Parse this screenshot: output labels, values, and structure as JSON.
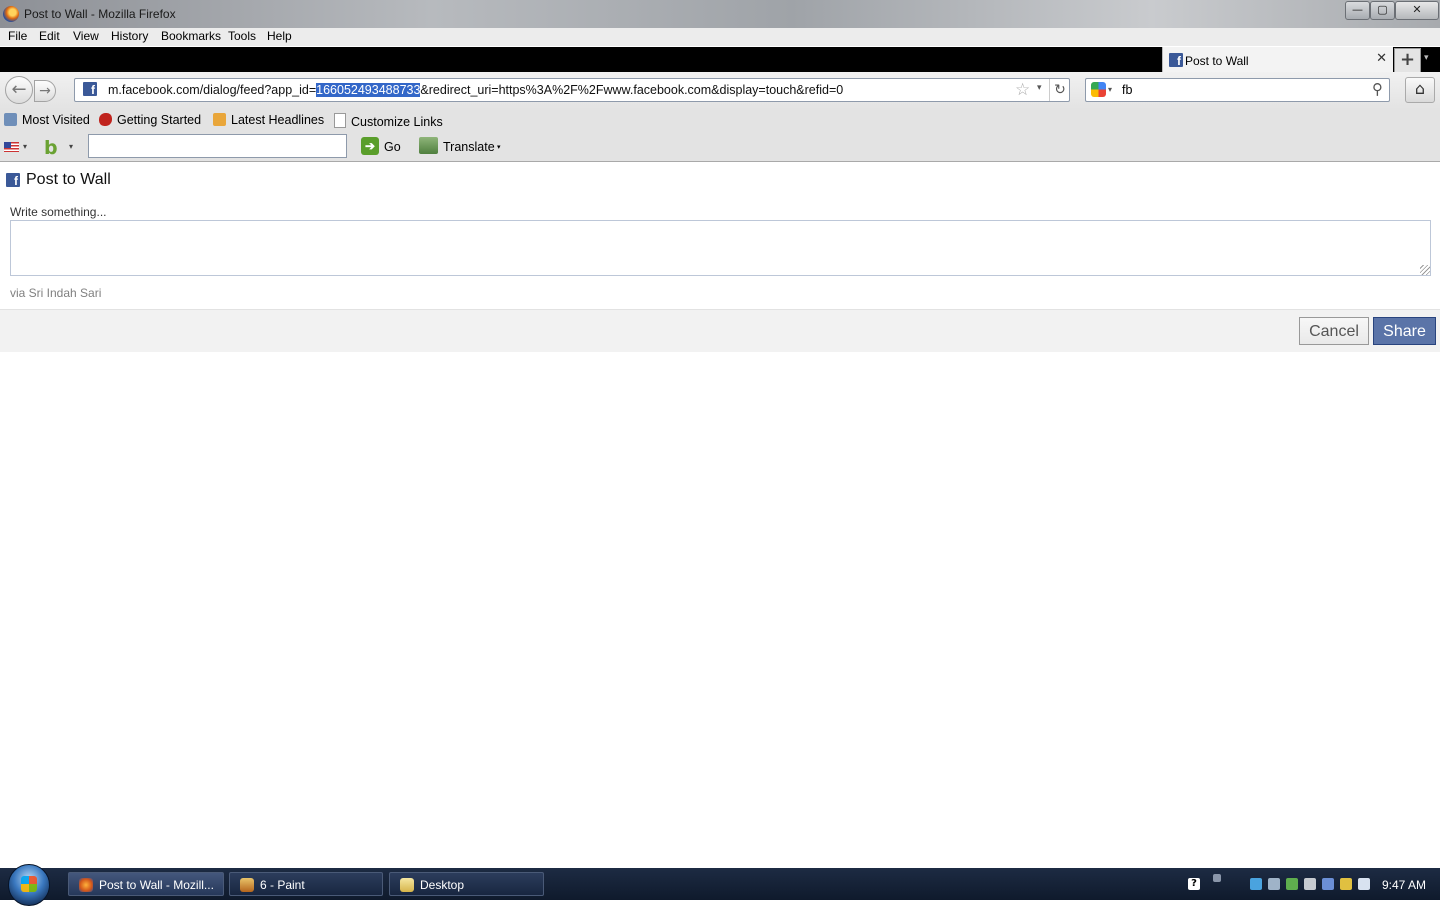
{
  "window": {
    "title": "Post to Wall - Mozilla Firefox",
    "min_glyph": "—",
    "max_glyph": "▢",
    "close_glyph": "✕"
  },
  "menu": [
    "File",
    "Edit",
    "View",
    "History",
    "Bookmarks",
    "Tools",
    "Help"
  ],
  "tab": {
    "title": "Post to Wall",
    "close_glyph": "✕",
    "new_tab_glyph": "+",
    "list_glyph": "▾"
  },
  "navbar": {
    "url_before": "m.facebook.com/dialog/feed?app_id=",
    "url_selected": "166052493488733",
    "url_after": "&redirect_uri=https%3A%2F%2Fwww.facebook.com&display=touch&refid=0",
    "search_value": "fb"
  },
  "bookmarks": [
    {
      "label": "Most Visited",
      "icon": "most-visited-icon"
    },
    {
      "label": "Getting Started",
      "icon": "getting-started-icon"
    },
    {
      "label": "Latest Headlines",
      "icon": "rss-feed-icon"
    },
    {
      "label": "Customize Links",
      "icon": "page-icon"
    }
  ],
  "addon_toolbar": {
    "input_value": "",
    "go_label": "Go",
    "translate_label": "Translate"
  },
  "dialog": {
    "title": "Post to Wall",
    "prompt": "Write something...",
    "message_value": "",
    "via": "via Sri Indah Sari",
    "cancel_label": "Cancel",
    "share_label": "Share"
  },
  "taskbar": {
    "tasks": [
      "Post to Wall - Mozill...",
      "6 - Paint",
      "Desktop"
    ],
    "clock": "9:47 AM"
  },
  "colors": {
    "facebook_blue": "#3b5998",
    "share_button": "#5b74a8",
    "url_selection": "#3367c8"
  }
}
